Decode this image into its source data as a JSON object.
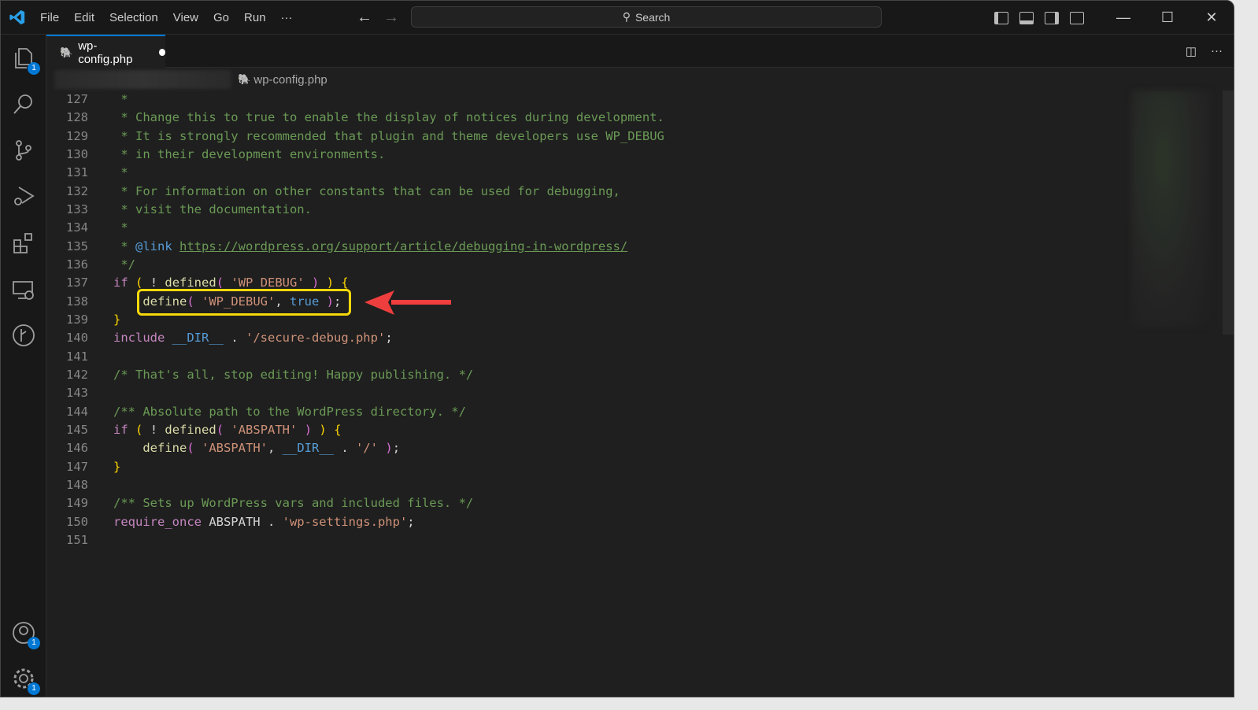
{
  "menu": [
    "File",
    "Edit",
    "Selection",
    "View",
    "Go",
    "Run",
    "···"
  ],
  "search": {
    "label": "Search"
  },
  "activity_badges": {
    "explorer": "1",
    "accounts": "1",
    "settings": "1"
  },
  "tab": {
    "label": "wp-config.php",
    "modified": true
  },
  "breadcrumb": {
    "file": "wp-config.php"
  },
  "highlighted_line": 138,
  "colors": {
    "accent": "#0078d4",
    "highlight_box": "#f5d90a",
    "arrow": "#ef3e3e"
  },
  "lines": [
    {
      "n": "127",
      "t": [
        [
          " *",
          "c"
        ]
      ]
    },
    {
      "n": "128",
      "t": [
        [
          " * Change this to true to enable the display of notices during development.",
          "c"
        ]
      ]
    },
    {
      "n": "129",
      "t": [
        [
          " * It is strongly recommended that plugin and theme developers use WP_DEBUG",
          "c"
        ]
      ]
    },
    {
      "n": "130",
      "t": [
        [
          " * in their development environments.",
          "c"
        ]
      ]
    },
    {
      "n": "131",
      "t": [
        [
          " *",
          "c"
        ]
      ]
    },
    {
      "n": "132",
      "t": [
        [
          " * For information on other constants that can be used for debugging,",
          "c"
        ]
      ]
    },
    {
      "n": "133",
      "t": [
        [
          " * visit the documentation.",
          "c"
        ]
      ]
    },
    {
      "n": "134",
      "t": [
        [
          " *",
          "c"
        ]
      ]
    },
    {
      "n": "135",
      "t": [
        [
          " * ",
          "c"
        ],
        [
          "@link",
          "b"
        ],
        [
          " ",
          "c"
        ],
        [
          "https://wordpress.org/support/article/debugging-in-wordpress/",
          "u"
        ]
      ]
    },
    {
      "n": "136",
      "t": [
        [
          " */",
          "c"
        ]
      ]
    },
    {
      "n": "137",
      "t": [
        [
          "if",
          "k"
        ],
        [
          " ",
          "t"
        ],
        [
          "(",
          "p1"
        ],
        [
          " ! ",
          "t"
        ],
        [
          "defined",
          "f"
        ],
        [
          "(",
          "p2"
        ],
        [
          " 'WP_DEBUG' ",
          "s"
        ],
        [
          ")",
          "p2"
        ],
        [
          " ",
          "t"
        ],
        [
          ")",
          "p1"
        ],
        [
          " ",
          "t"
        ],
        [
          "{",
          "p1"
        ]
      ]
    },
    {
      "n": "138",
      "t": [
        [
          "    ",
          "t"
        ],
        [
          "define",
          "f"
        ],
        [
          "(",
          "p2"
        ],
        [
          " 'WP_DEBUG'",
          "s"
        ],
        [
          ", ",
          "t"
        ],
        [
          "true",
          "b"
        ],
        [
          " ",
          "t"
        ],
        [
          ")",
          "p2"
        ],
        [
          ";",
          "t"
        ]
      ]
    },
    {
      "n": "139",
      "t": [
        [
          "}",
          "p1"
        ]
      ]
    },
    {
      "n": "140",
      "t": [
        [
          "include",
          "k"
        ],
        [
          " ",
          "t"
        ],
        [
          "__DIR__",
          "b"
        ],
        [
          " . ",
          "t"
        ],
        [
          "'/secure-debug.php'",
          "s"
        ],
        [
          ";",
          "t"
        ]
      ]
    },
    {
      "n": "141",
      "t": []
    },
    {
      "n": "142",
      "t": [
        [
          "/* That's all, stop editing! Happy publishing. */",
          "c"
        ]
      ]
    },
    {
      "n": "143",
      "t": []
    },
    {
      "n": "144",
      "t": [
        [
          "/** Absolute path to the WordPress directory. */",
          "c"
        ]
      ]
    },
    {
      "n": "145",
      "t": [
        [
          "if",
          "k"
        ],
        [
          " ",
          "t"
        ],
        [
          "(",
          "p1"
        ],
        [
          " ! ",
          "t"
        ],
        [
          "defined",
          "f"
        ],
        [
          "(",
          "p2"
        ],
        [
          " 'ABSPATH' ",
          "s"
        ],
        [
          ")",
          "p2"
        ],
        [
          " ",
          "t"
        ],
        [
          ")",
          "p1"
        ],
        [
          " ",
          "t"
        ],
        [
          "{",
          "p1"
        ]
      ]
    },
    {
      "n": "146",
      "t": [
        [
          "    ",
          "t"
        ],
        [
          "define",
          "f"
        ],
        [
          "(",
          "p2"
        ],
        [
          " 'ABSPATH'",
          "s"
        ],
        [
          ", ",
          "t"
        ],
        [
          "__DIR__",
          "b"
        ],
        [
          " . ",
          "t"
        ],
        [
          "'/'",
          "s"
        ],
        [
          " ",
          "t"
        ],
        [
          ")",
          "p2"
        ],
        [
          ";",
          "t"
        ]
      ]
    },
    {
      "n": "147",
      "t": [
        [
          "}",
          "p1"
        ]
      ]
    },
    {
      "n": "148",
      "t": []
    },
    {
      "n": "149",
      "t": [
        [
          "/** Sets up WordPress vars and included files. */",
          "c"
        ]
      ]
    },
    {
      "n": "150",
      "t": [
        [
          "require_once",
          "k"
        ],
        [
          " ABSPATH . ",
          "t"
        ],
        [
          "'wp-settings.php'",
          "s"
        ],
        [
          ";",
          "t"
        ]
      ]
    },
    {
      "n": "151",
      "t": []
    }
  ]
}
